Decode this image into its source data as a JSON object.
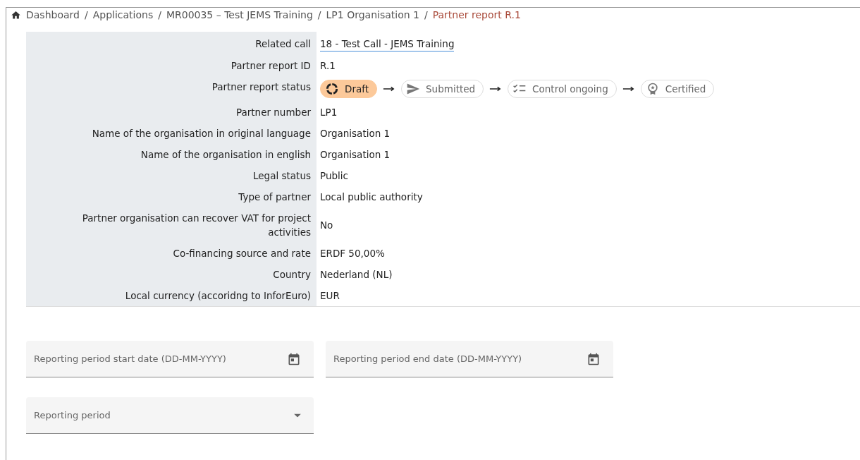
{
  "breadcrumb_separator": "/",
  "breadcrumb": [
    {
      "label": "Dashboard",
      "selected": false
    },
    {
      "label": "Applications",
      "selected": false
    },
    {
      "label": "MR00035 – Test JEMS Training",
      "selected": false
    },
    {
      "label": "LP1 Organisation 1",
      "selected": false
    },
    {
      "label": "Partner report R.1",
      "selected": true
    }
  ],
  "details": [
    {
      "label": "Related call",
      "kind": "link",
      "value": "18 - Test Call - JEMS Training"
    },
    {
      "label": "Partner report ID",
      "kind": "text",
      "value": "R.1"
    },
    {
      "label": "Partner report status",
      "kind": "status"
    },
    {
      "label": "Partner number",
      "kind": "text",
      "value": "LP1"
    },
    {
      "label": "Name of the organisation in original language",
      "kind": "text",
      "value": "Organisation 1"
    },
    {
      "label": "Name of the organisation in english",
      "kind": "text",
      "value": "Organisation 1"
    },
    {
      "label": "Legal status",
      "kind": "text",
      "value": "Public"
    },
    {
      "label": "Type of partner",
      "kind": "text",
      "value": "Local public authority"
    },
    {
      "label": "Partner organisation can recover VAT for project activities",
      "kind": "text",
      "value": "No"
    },
    {
      "label": "Co-financing source and rate",
      "kind": "text",
      "value": "ERDF 50,00%"
    },
    {
      "label": "Country",
      "kind": "text",
      "value": "Nederland (NL)"
    },
    {
      "label": "Local currency (accoridng to InforEuro)",
      "kind": "text",
      "value": "EUR"
    }
  ],
  "status_steps": [
    {
      "label": "Draft",
      "kind": "draft",
      "selected": true
    },
    {
      "label": "Submitted",
      "kind": "submitted",
      "selected": false
    },
    {
      "label": "Control ongoing",
      "kind": "control",
      "selected": false
    },
    {
      "label": "Certified",
      "kind": "certified",
      "selected": false
    }
  ],
  "fields": [
    {
      "placeholder": "Reporting period start date (DD-MM-YYYY)",
      "kind": "date"
    },
    {
      "placeholder": "Reporting period end date (DD-MM-YYYY)",
      "kind": "date"
    },
    {
      "placeholder": "Reporting period",
      "kind": "select"
    }
  ]
}
